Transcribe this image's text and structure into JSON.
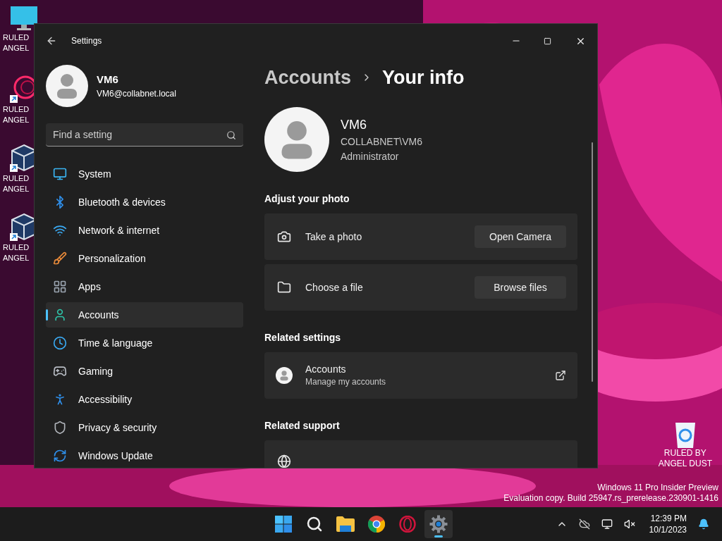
{
  "desktop": {
    "icons": [
      {
        "kind": "monitor",
        "lines": [
          "RULED",
          "ANGEL"
        ]
      },
      {
        "kind": "ring",
        "lines": [
          "RULED",
          "ANGEL"
        ]
      },
      {
        "kind": "cube",
        "lines": [
          "RULED",
          "ANGEL"
        ]
      },
      {
        "kind": "cube",
        "lines": [
          "RULED",
          "ANGEL"
        ]
      }
    ],
    "recycle_bin": {
      "lines": [
        "RULED BY",
        "ANGEL DUST"
      ]
    },
    "build_info": [
      "Windows 11 Pro Insider Preview",
      "Evaluation copy. Build 25947.rs_prerelease.230901-1416"
    ]
  },
  "window": {
    "title": "Settings",
    "profile": {
      "name": "VM6",
      "email": "VM6@collabnet.local"
    },
    "search": {
      "placeholder": "Find a setting"
    },
    "nav": [
      {
        "label": "System",
        "selected": false
      },
      {
        "label": "Bluetooth & devices",
        "selected": false
      },
      {
        "label": "Network & internet",
        "selected": false
      },
      {
        "label": "Personalization",
        "selected": false
      },
      {
        "label": "Apps",
        "selected": false
      },
      {
        "label": "Accounts",
        "selected": true
      },
      {
        "label": "Time & language",
        "selected": false
      },
      {
        "label": "Gaming",
        "selected": false
      },
      {
        "label": "Accessibility",
        "selected": false
      },
      {
        "label": "Privacy & security",
        "selected": false
      },
      {
        "label": "Windows Update",
        "selected": false
      }
    ],
    "breadcrumb": {
      "parent": "Accounts",
      "current": "Your info"
    },
    "user": {
      "name": "VM6",
      "domain": "COLLABNET\\VM6",
      "role": "Administrator"
    },
    "sections": [
      {
        "heading": "Adjust your photo",
        "cards": [
          {
            "kind": "camera",
            "label": "Take a photo",
            "button": "Open Camera"
          },
          {
            "kind": "file",
            "label": "Choose a file",
            "button": "Browse files"
          }
        ]
      },
      {
        "heading": "Related settings",
        "cards": [
          {
            "kind": "link",
            "label": "Accounts",
            "description": "Manage my accounts"
          }
        ]
      },
      {
        "heading": "Related support",
        "cards": [
          {
            "kind": "cut"
          }
        ]
      }
    ]
  },
  "taskbar": {
    "apps": [
      {
        "kind": "start",
        "selected": false
      },
      {
        "kind": "search",
        "selected": false
      },
      {
        "kind": "explorer",
        "selected": false
      },
      {
        "kind": "chrome",
        "selected": false
      },
      {
        "kind": "opera",
        "selected": false
      },
      {
        "kind": "settings",
        "selected": true
      }
    ],
    "clock": {
      "time": "12:39 PM",
      "date": "10/1/2023"
    }
  }
}
